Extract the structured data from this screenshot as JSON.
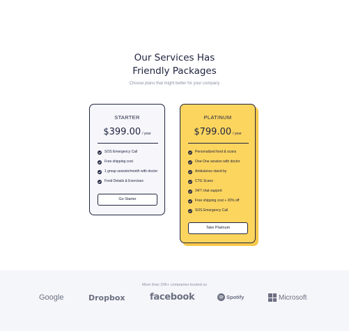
{
  "hero": {
    "title_line1": "Our Services Has",
    "title_line2": "Friendly Packages",
    "subtitle": "Choose plans that might better for your company"
  },
  "plans": [
    {
      "name": "STARTER",
      "price": "$399.00",
      "period": "/ year",
      "features": [
        "SOS Emergency Call",
        "Free shipping cost",
        "1 group session/month with doctor",
        "Food Details & Exercises"
      ],
      "button": "Go Starter"
    },
    {
      "name": "PLATINUM",
      "price": "$799.00",
      "period": "/ year",
      "features": [
        "Personalized food & scans",
        "One-One session with doctor",
        "Ambulance stand by",
        "CTG Scans",
        "24/7 chat support",
        "Free shipping cost + 20% off",
        "SOS Emergency Call"
      ],
      "button": "Take Platinum"
    }
  ],
  "trusted": {
    "text": "More than 10K+ companies trusted us",
    "logos": [
      "Google",
      "Dropbox",
      "facebook",
      "Spotify",
      "Microsoft"
    ]
  },
  "colors": {
    "accent": "#fcd55f",
    "accent_shadow": "#f8c84a",
    "ink": "#20243f",
    "muted": "#8a8fa3",
    "band": "#f5f6fa"
  }
}
